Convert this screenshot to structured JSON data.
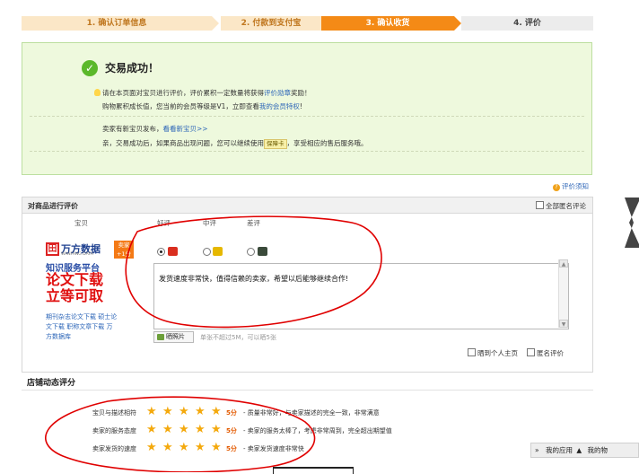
{
  "steps": [
    {
      "label": "1. 确认订单信息",
      "state": "done"
    },
    {
      "label": "2. 付款到支付宝",
      "state": "done"
    },
    {
      "label": "3. 确认收货",
      "state": "active"
    },
    {
      "label": "4. 评价",
      "state": "todo"
    }
  ],
  "success": {
    "title": "交易成功！",
    "line1_prefix": "请在本页面对宝贝进行评价，评价累积一定数量将获得",
    "line1_link": "评价勋章",
    "line1_suffix": "奖励！",
    "line2_prefix": "购物累积成长值，您当前的会员等级是V1，立即查看",
    "line2_link": "我的会员特权",
    "line2_suffix": "!",
    "line3_prefix": "卖家有新宝贝发布，",
    "line3_link": "看看新宝贝>>",
    "line4_prefix": "亲，交易成功后，如果商品出现问题，您可以继续使用",
    "line4_badge": "保障卡",
    "line4_suffix": "，享受相应的售后服务哦。"
  },
  "rating_tips": "评价须知",
  "panel": {
    "title": "对商品进行评价",
    "anon_all": "全部匿名评论",
    "col_item": "宝贝",
    "col_good": "好评",
    "col_mid": "中评",
    "col_bad": "差评",
    "comment": "发货速度非常快，值得信赖的卖家，希望以后能够继续合作!",
    "upload_label": "晒照片",
    "upload_hint": "单张不超过5M，可以晒5张",
    "option_home": "晒到个人主页",
    "option_anon": "匿名评价"
  },
  "ad": {
    "logo_mark": "田",
    "logo_text": "万方数据",
    "logo_sub": "WANFANG DATA",
    "badge_line1": "卖家",
    "badge_line2": "+1分",
    "line1": "知识服务平台",
    "line2": "论文下载",
    "line3": "立等可取",
    "links": "期刊杂志论文下载 硕士论文下载 职称文章下载 万方数据库"
  },
  "shop": {
    "title": "店铺动态评分",
    "rows": [
      {
        "label": "宝贝与描述相符",
        "stars": 5,
        "score": "5分",
        "desc": "- 质量非常好，与卖家描述的完全一致，非常满意"
      },
      {
        "label": "卖家的服务态度",
        "stars": 5,
        "score": "5分",
        "desc": "- 卖家的服务太棒了，考虑非常周到，完全超出期望值"
      },
      {
        "label": "卖家发货的速度",
        "stars": 5,
        "score": "5分",
        "desc": "- 卖家发货速度非常快"
      }
    ]
  },
  "bottom_bar": {
    "chevron": "»",
    "app1": "我的应用",
    "app2": "我的物"
  },
  "colors": {
    "active_step": "#f48a16",
    "success_bg": "#eef9dd",
    "annotation": "#e00000",
    "link": "#2d66b8",
    "star": "#f4a90d"
  }
}
